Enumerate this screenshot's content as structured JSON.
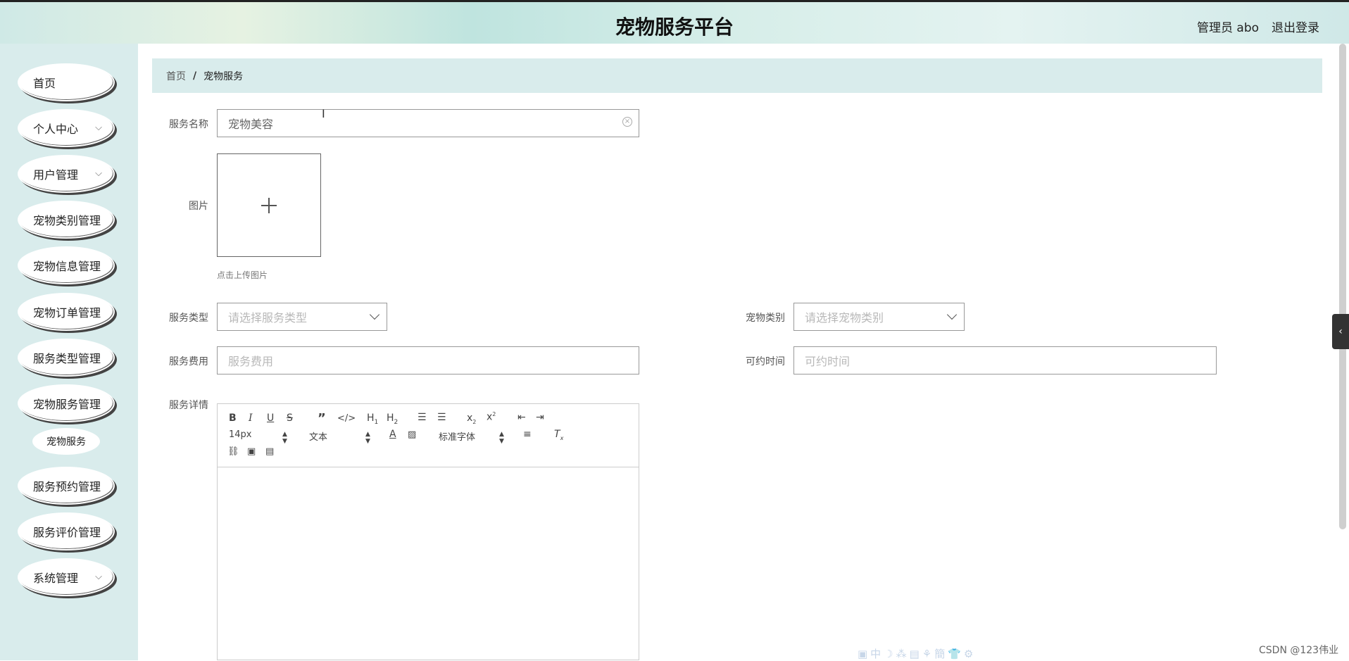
{
  "header": {
    "title": "宠物服务平台",
    "admin": "管理员 abo",
    "logout": "退出登录"
  },
  "sidebar": {
    "items": [
      {
        "label": "首页",
        "has_chevron": false
      },
      {
        "label": "个人中心",
        "has_chevron": true
      },
      {
        "label": "用户管理",
        "has_chevron": true
      },
      {
        "label": "宠物类别管理",
        "has_chevron": false
      },
      {
        "label": "宠物信息管理",
        "has_chevron": false
      },
      {
        "label": "宠物订单管理",
        "has_chevron": false
      },
      {
        "label": "服务类型管理",
        "has_chevron": false
      },
      {
        "label": "宠物服务管理",
        "has_chevron": false
      },
      {
        "label": "服务预约管理",
        "has_chevron": false
      },
      {
        "label": "服务评价管理",
        "has_chevron": false
      },
      {
        "label": "系统管理",
        "has_chevron": true
      }
    ],
    "sub_item": "宠物服务"
  },
  "breadcrumb": {
    "home": "首页",
    "separator": "/",
    "current": "宠物服务"
  },
  "form": {
    "service_name": {
      "label": "服务名称",
      "value": "宠物美容"
    },
    "image": {
      "label": "图片",
      "tip": "点击上传图片"
    },
    "service_type": {
      "label": "服务类型",
      "placeholder": "请选择服务类型"
    },
    "pet_category": {
      "label": "宠物类别",
      "placeholder": "请选择宠物类别"
    },
    "service_fee": {
      "label": "服务费用",
      "placeholder": "服务费用"
    },
    "available_time": {
      "label": "可约时间",
      "placeholder": "可约时间"
    },
    "details": {
      "label": "服务详情"
    }
  },
  "editor": {
    "font_size": "14px",
    "text_style": "文本",
    "font_family": "标准字体"
  },
  "footer": {
    "watermark": "CSDN @123伟业"
  }
}
